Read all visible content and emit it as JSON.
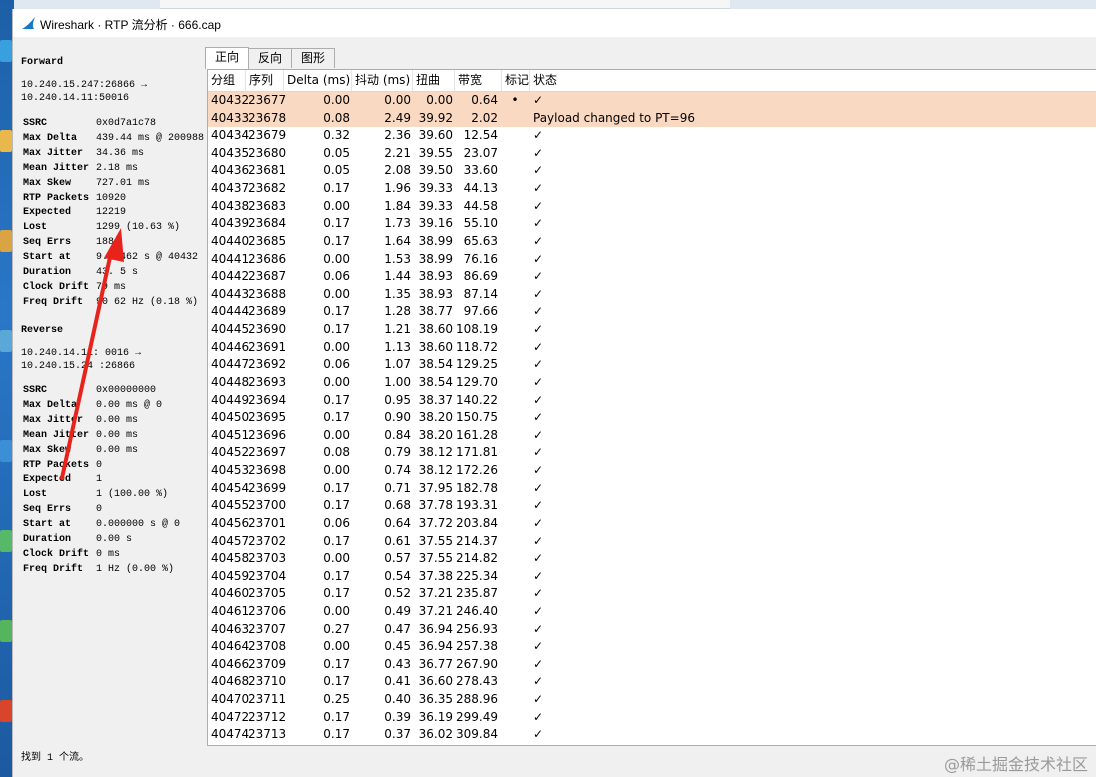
{
  "window": {
    "title": "Wireshark · RTP 流分析 · 666.cap"
  },
  "forward": {
    "title": "Forward",
    "addr_line1": "10.240.15.247:26866 →",
    "addr_line2": "10.240.14.11:50016",
    "stats": [
      {
        "key": "SSRC",
        "value": "0x0d7a1c78"
      },
      {
        "key": "Max Delta",
        "value": "439.44 ms @ 200988"
      },
      {
        "key": "Max Jitter",
        "value": "34.36 ms"
      },
      {
        "key": "Mean Jitter",
        "value": "2.18 ms"
      },
      {
        "key": "Max Skew",
        "value": "727.01 ms"
      },
      {
        "key": "RTP Packets",
        "value": "10920"
      },
      {
        "key": "Expected",
        "value": "12219"
      },
      {
        "key": "Lost",
        "value": "1299 (10.63 %)"
      },
      {
        "key": "Seq Errs",
        "value": "188"
      },
      {
        "key": "Start at",
        "value": "9.9 462 s @ 40432"
      },
      {
        "key": "Duration",
        "value": "43. 5 s"
      },
      {
        "key": "Clock Drift",
        "value": "79 ms"
      },
      {
        "key": "Freq Drift",
        "value": "90 62 Hz (0.18 %)"
      }
    ]
  },
  "reverse": {
    "title": "Reverse",
    "addr_line1": "10.240.14.11: 0016 →",
    "addr_line2": "10.240.15.24 :26866",
    "stats": [
      {
        "key": "SSRC",
        "value": "0x00000000"
      },
      {
        "key": "Max Delta",
        "value": "0.00 ms @ 0"
      },
      {
        "key": "Max Jitter",
        "value": "0.00 ms"
      },
      {
        "key": "Mean Jitter",
        "value": "0.00 ms"
      },
      {
        "key": "Max Skew",
        "value": "0.00 ms"
      },
      {
        "key": "RTP Packets",
        "value": "0"
      },
      {
        "key": "Expected",
        "value": "1"
      },
      {
        "key": "Lost",
        "value": "1 (100.00 %)"
      },
      {
        "key": "Seq Errs",
        "value": "0"
      },
      {
        "key": "Start at",
        "value": "0.000000 s @ 0"
      },
      {
        "key": "Duration",
        "value": "0.00 s"
      },
      {
        "key": "Clock Drift",
        "value": "0 ms"
      },
      {
        "key": "Freq Drift",
        "value": "1 Hz (0.00 %)"
      }
    ]
  },
  "tabs": [
    "正向",
    "反向",
    "图形"
  ],
  "columns": [
    "分组",
    "序列",
    "Delta (ms)",
    "抖动 (ms)",
    "扭曲",
    "带宽",
    "标记",
    "状态"
  ],
  "rows": [
    {
      "pkt": "40432",
      "seq": "23677",
      "delta": "0.00",
      "jitter": "0.00",
      "skew": "0.00",
      "bw": "0.64",
      "mark": "•",
      "status": "✓",
      "hl": true
    },
    {
      "pkt": "40433",
      "seq": "23678",
      "delta": "0.08",
      "jitter": "2.49",
      "skew": "39.92",
      "bw": "2.02",
      "mark": "",
      "status": "Payload changed to PT=96",
      "hl": true
    },
    {
      "pkt": "40434",
      "seq": "23679",
      "delta": "0.32",
      "jitter": "2.36",
      "skew": "39.60",
      "bw": "12.54",
      "mark": "",
      "status": "✓"
    },
    {
      "pkt": "40435",
      "seq": "23680",
      "delta": "0.05",
      "jitter": "2.21",
      "skew": "39.55",
      "bw": "23.07",
      "mark": "",
      "status": "✓"
    },
    {
      "pkt": "40436",
      "seq": "23681",
      "delta": "0.05",
      "jitter": "2.08",
      "skew": "39.50",
      "bw": "33.60",
      "mark": "",
      "status": "✓"
    },
    {
      "pkt": "40437",
      "seq": "23682",
      "delta": "0.17",
      "jitter": "1.96",
      "skew": "39.33",
      "bw": "44.13",
      "mark": "",
      "status": "✓"
    },
    {
      "pkt": "40438",
      "seq": "23683",
      "delta": "0.00",
      "jitter": "1.84",
      "skew": "39.33",
      "bw": "44.58",
      "mark": "",
      "status": "✓"
    },
    {
      "pkt": "40439",
      "seq": "23684",
      "delta": "0.17",
      "jitter": "1.73",
      "skew": "39.16",
      "bw": "55.10",
      "mark": "",
      "status": "✓"
    },
    {
      "pkt": "40440",
      "seq": "23685",
      "delta": "0.17",
      "jitter": "1.64",
      "skew": "38.99",
      "bw": "65.63",
      "mark": "",
      "status": "✓"
    },
    {
      "pkt": "40441",
      "seq": "23686",
      "delta": "0.00",
      "jitter": "1.53",
      "skew": "38.99",
      "bw": "76.16",
      "mark": "",
      "status": "✓"
    },
    {
      "pkt": "40442",
      "seq": "23687",
      "delta": "0.06",
      "jitter": "1.44",
      "skew": "38.93",
      "bw": "86.69",
      "mark": "",
      "status": "✓"
    },
    {
      "pkt": "40443",
      "seq": "23688",
      "delta": "0.00",
      "jitter": "1.35",
      "skew": "38.93",
      "bw": "87.14",
      "mark": "",
      "status": "✓"
    },
    {
      "pkt": "40444",
      "seq": "23689",
      "delta": "0.17",
      "jitter": "1.28",
      "skew": "38.77",
      "bw": "97.66",
      "mark": "",
      "status": "✓"
    },
    {
      "pkt": "40445",
      "seq": "23690",
      "delta": "0.17",
      "jitter": "1.21",
      "skew": "38.60",
      "bw": "108.19",
      "mark": "",
      "status": "✓"
    },
    {
      "pkt": "40446",
      "seq": "23691",
      "delta": "0.00",
      "jitter": "1.13",
      "skew": "38.60",
      "bw": "118.72",
      "mark": "",
      "status": "✓"
    },
    {
      "pkt": "40447",
      "seq": "23692",
      "delta": "0.06",
      "jitter": "1.07",
      "skew": "38.54",
      "bw": "129.25",
      "mark": "",
      "status": "✓"
    },
    {
      "pkt": "40448",
      "seq": "23693",
      "delta": "0.00",
      "jitter": "1.00",
      "skew": "38.54",
      "bw": "129.70",
      "mark": "",
      "status": "✓"
    },
    {
      "pkt": "40449",
      "seq": "23694",
      "delta": "0.17",
      "jitter": "0.95",
      "skew": "38.37",
      "bw": "140.22",
      "mark": "",
      "status": "✓"
    },
    {
      "pkt": "40450",
      "seq": "23695",
      "delta": "0.17",
      "jitter": "0.90",
      "skew": "38.20",
      "bw": "150.75",
      "mark": "",
      "status": "✓"
    },
    {
      "pkt": "40451",
      "seq": "23696",
      "delta": "0.00",
      "jitter": "0.84",
      "skew": "38.20",
      "bw": "161.28",
      "mark": "",
      "status": "✓"
    },
    {
      "pkt": "40452",
      "seq": "23697",
      "delta": "0.08",
      "jitter": "0.79",
      "skew": "38.12",
      "bw": "171.81",
      "mark": "",
      "status": "✓"
    },
    {
      "pkt": "40453",
      "seq": "23698",
      "delta": "0.00",
      "jitter": "0.74",
      "skew": "38.12",
      "bw": "172.26",
      "mark": "",
      "status": "✓"
    },
    {
      "pkt": "40454",
      "seq": "23699",
      "delta": "0.17",
      "jitter": "0.71",
      "skew": "37.95",
      "bw": "182.78",
      "mark": "",
      "status": "✓"
    },
    {
      "pkt": "40455",
      "seq": "23700",
      "delta": "0.17",
      "jitter": "0.68",
      "skew": "37.78",
      "bw": "193.31",
      "mark": "",
      "status": "✓"
    },
    {
      "pkt": "40456",
      "seq": "23701",
      "delta": "0.06",
      "jitter": "0.64",
      "skew": "37.72",
      "bw": "203.84",
      "mark": "",
      "status": "✓"
    },
    {
      "pkt": "40457",
      "seq": "23702",
      "delta": "0.17",
      "jitter": "0.61",
      "skew": "37.55",
      "bw": "214.37",
      "mark": "",
      "status": "✓"
    },
    {
      "pkt": "40458",
      "seq": "23703",
      "delta": "0.00",
      "jitter": "0.57",
      "skew": "37.55",
      "bw": "214.82",
      "mark": "",
      "status": "✓"
    },
    {
      "pkt": "40459",
      "seq": "23704",
      "delta": "0.17",
      "jitter": "0.54",
      "skew": "37.38",
      "bw": "225.34",
      "mark": "",
      "status": "✓"
    },
    {
      "pkt": "40460",
      "seq": "23705",
      "delta": "0.17",
      "jitter": "0.52",
      "skew": "37.21",
      "bw": "235.87",
      "mark": "",
      "status": "✓"
    },
    {
      "pkt": "40461",
      "seq": "23706",
      "delta": "0.00",
      "jitter": "0.49",
      "skew": "37.21",
      "bw": "246.40",
      "mark": "",
      "status": "✓"
    },
    {
      "pkt": "40463",
      "seq": "23707",
      "delta": "0.27",
      "jitter": "0.47",
      "skew": "36.94",
      "bw": "256.93",
      "mark": "",
      "status": "✓"
    },
    {
      "pkt": "40464",
      "seq": "23708",
      "delta": "0.00",
      "jitter": "0.45",
      "skew": "36.94",
      "bw": "257.38",
      "mark": "",
      "status": "✓"
    },
    {
      "pkt": "40466",
      "seq": "23709",
      "delta": "0.17",
      "jitter": "0.43",
      "skew": "36.77",
      "bw": "267.90",
      "mark": "",
      "status": "✓"
    },
    {
      "pkt": "40468",
      "seq": "23710",
      "delta": "0.17",
      "jitter": "0.41",
      "skew": "36.60",
      "bw": "278.43",
      "mark": "",
      "status": "✓"
    },
    {
      "pkt": "40470",
      "seq": "23711",
      "delta": "0.25",
      "jitter": "0.40",
      "skew": "36.35",
      "bw": "288.96",
      "mark": "",
      "status": "✓"
    },
    {
      "pkt": "40472",
      "seq": "23712",
      "delta": "0.17",
      "jitter": "0.39",
      "skew": "36.19",
      "bw": "299.49",
      "mark": "",
      "status": "✓"
    },
    {
      "pkt": "40474",
      "seq": "23713",
      "delta": "0.17",
      "jitter": "0.37",
      "skew": "36.02",
      "bw": "309.84",
      "mark": "",
      "status": "✓"
    }
  ],
  "statusbar": "找到 1 个流。",
  "watermark": "@稀土掘金技术社区",
  "colors": {
    "highlight_row": "#fad9c2",
    "annotation_arrow": "#e8231b"
  }
}
